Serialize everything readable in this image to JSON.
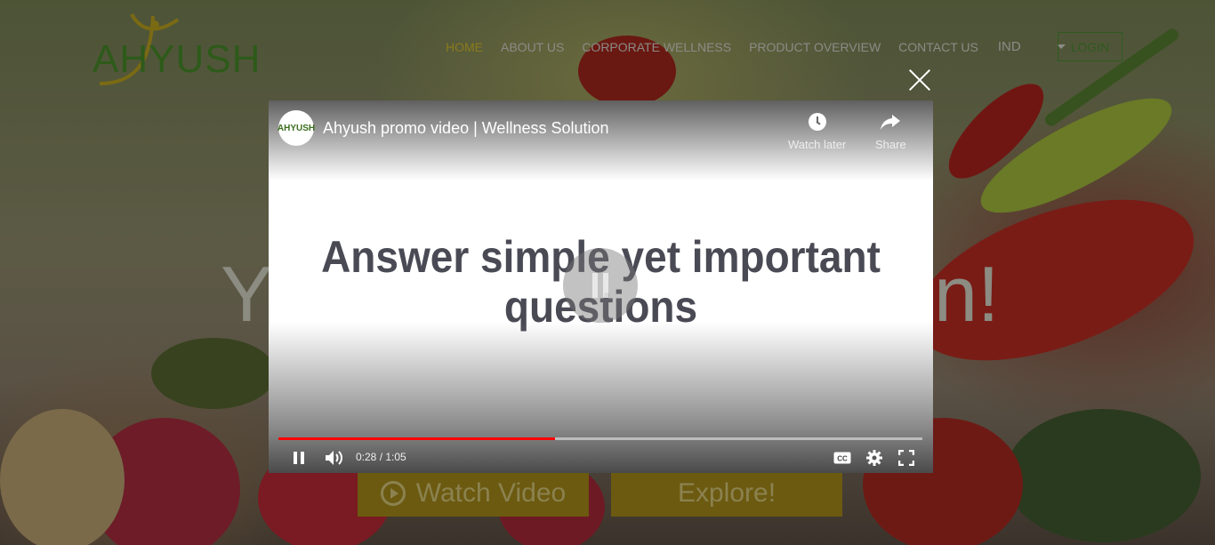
{
  "header": {
    "logo_text": "AHYUSH",
    "nav": [
      {
        "label": "HOME",
        "active": true
      },
      {
        "label": "ABOUT US"
      },
      {
        "label": "CORPORATE WELLNESS"
      },
      {
        "label": "PRODUCT OVERVIEW"
      },
      {
        "label": "CONTACT US"
      }
    ],
    "language": "IND",
    "login_label": "LOGIN"
  },
  "hero": {
    "partial_left": "Y",
    "partial_right": "n!",
    "watch_video_label": "Watch Video",
    "explore_label": "Explore!"
  },
  "video": {
    "channel_avatar_text": "AHYUSH",
    "title": "Ahyush promo video | Wellness Solution",
    "watch_later_label": "Watch later",
    "share_label": "Share",
    "slide_text_line1": "Answer simple yet important",
    "slide_text_line2": "questions",
    "time_display": "0:28 / 1:05",
    "progress": 0.43
  },
  "colors": {
    "accent_active": "#8a7a1c",
    "login_border": "#2f5a1e",
    "progress_red": "#ff0000",
    "cta_bg": "#6b5a10"
  }
}
